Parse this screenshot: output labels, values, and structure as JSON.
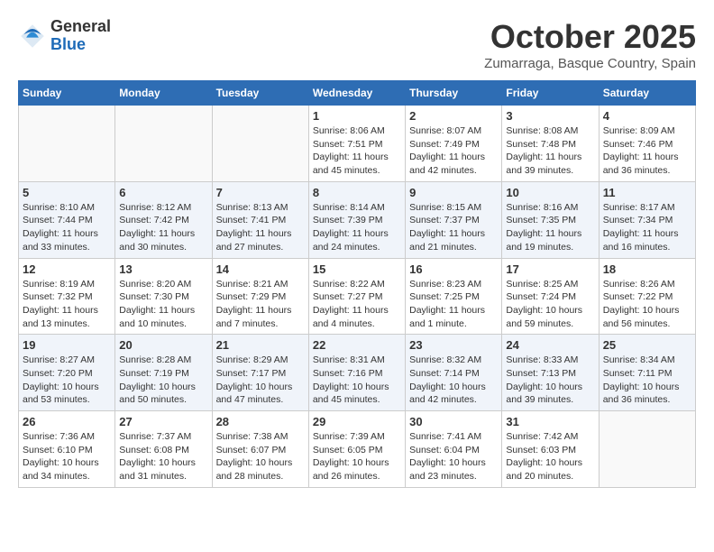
{
  "logo": {
    "general": "General",
    "blue": "Blue"
  },
  "title": "October 2025",
  "location": "Zumarraga, Basque Country, Spain",
  "weekdays": [
    "Sunday",
    "Monday",
    "Tuesday",
    "Wednesday",
    "Thursday",
    "Friday",
    "Saturday"
  ],
  "weeks": [
    [
      {
        "day": "",
        "info": ""
      },
      {
        "day": "",
        "info": ""
      },
      {
        "day": "",
        "info": ""
      },
      {
        "day": "1",
        "info": "Sunrise: 8:06 AM\nSunset: 7:51 PM\nDaylight: 11 hours and 45 minutes."
      },
      {
        "day": "2",
        "info": "Sunrise: 8:07 AM\nSunset: 7:49 PM\nDaylight: 11 hours and 42 minutes."
      },
      {
        "day": "3",
        "info": "Sunrise: 8:08 AM\nSunset: 7:48 PM\nDaylight: 11 hours and 39 minutes."
      },
      {
        "day": "4",
        "info": "Sunrise: 8:09 AM\nSunset: 7:46 PM\nDaylight: 11 hours and 36 minutes."
      }
    ],
    [
      {
        "day": "5",
        "info": "Sunrise: 8:10 AM\nSunset: 7:44 PM\nDaylight: 11 hours and 33 minutes."
      },
      {
        "day": "6",
        "info": "Sunrise: 8:12 AM\nSunset: 7:42 PM\nDaylight: 11 hours and 30 minutes."
      },
      {
        "day": "7",
        "info": "Sunrise: 8:13 AM\nSunset: 7:41 PM\nDaylight: 11 hours and 27 minutes."
      },
      {
        "day": "8",
        "info": "Sunrise: 8:14 AM\nSunset: 7:39 PM\nDaylight: 11 hours and 24 minutes."
      },
      {
        "day": "9",
        "info": "Sunrise: 8:15 AM\nSunset: 7:37 PM\nDaylight: 11 hours and 21 minutes."
      },
      {
        "day": "10",
        "info": "Sunrise: 8:16 AM\nSunset: 7:35 PM\nDaylight: 11 hours and 19 minutes."
      },
      {
        "day": "11",
        "info": "Sunrise: 8:17 AM\nSunset: 7:34 PM\nDaylight: 11 hours and 16 minutes."
      }
    ],
    [
      {
        "day": "12",
        "info": "Sunrise: 8:19 AM\nSunset: 7:32 PM\nDaylight: 11 hours and 13 minutes."
      },
      {
        "day": "13",
        "info": "Sunrise: 8:20 AM\nSunset: 7:30 PM\nDaylight: 11 hours and 10 minutes."
      },
      {
        "day": "14",
        "info": "Sunrise: 8:21 AM\nSunset: 7:29 PM\nDaylight: 11 hours and 7 minutes."
      },
      {
        "day": "15",
        "info": "Sunrise: 8:22 AM\nSunset: 7:27 PM\nDaylight: 11 hours and 4 minutes."
      },
      {
        "day": "16",
        "info": "Sunrise: 8:23 AM\nSunset: 7:25 PM\nDaylight: 11 hours and 1 minute."
      },
      {
        "day": "17",
        "info": "Sunrise: 8:25 AM\nSunset: 7:24 PM\nDaylight: 10 hours and 59 minutes."
      },
      {
        "day": "18",
        "info": "Sunrise: 8:26 AM\nSunset: 7:22 PM\nDaylight: 10 hours and 56 minutes."
      }
    ],
    [
      {
        "day": "19",
        "info": "Sunrise: 8:27 AM\nSunset: 7:20 PM\nDaylight: 10 hours and 53 minutes."
      },
      {
        "day": "20",
        "info": "Sunrise: 8:28 AM\nSunset: 7:19 PM\nDaylight: 10 hours and 50 minutes."
      },
      {
        "day": "21",
        "info": "Sunrise: 8:29 AM\nSunset: 7:17 PM\nDaylight: 10 hours and 47 minutes."
      },
      {
        "day": "22",
        "info": "Sunrise: 8:31 AM\nSunset: 7:16 PM\nDaylight: 10 hours and 45 minutes."
      },
      {
        "day": "23",
        "info": "Sunrise: 8:32 AM\nSunset: 7:14 PM\nDaylight: 10 hours and 42 minutes."
      },
      {
        "day": "24",
        "info": "Sunrise: 8:33 AM\nSunset: 7:13 PM\nDaylight: 10 hours and 39 minutes."
      },
      {
        "day": "25",
        "info": "Sunrise: 8:34 AM\nSunset: 7:11 PM\nDaylight: 10 hours and 36 minutes."
      }
    ],
    [
      {
        "day": "26",
        "info": "Sunrise: 7:36 AM\nSunset: 6:10 PM\nDaylight: 10 hours and 34 minutes."
      },
      {
        "day": "27",
        "info": "Sunrise: 7:37 AM\nSunset: 6:08 PM\nDaylight: 10 hours and 31 minutes."
      },
      {
        "day": "28",
        "info": "Sunrise: 7:38 AM\nSunset: 6:07 PM\nDaylight: 10 hours and 28 minutes."
      },
      {
        "day": "29",
        "info": "Sunrise: 7:39 AM\nSunset: 6:05 PM\nDaylight: 10 hours and 26 minutes."
      },
      {
        "day": "30",
        "info": "Sunrise: 7:41 AM\nSunset: 6:04 PM\nDaylight: 10 hours and 23 minutes."
      },
      {
        "day": "31",
        "info": "Sunrise: 7:42 AM\nSunset: 6:03 PM\nDaylight: 10 hours and 20 minutes."
      },
      {
        "day": "",
        "info": ""
      }
    ]
  ]
}
